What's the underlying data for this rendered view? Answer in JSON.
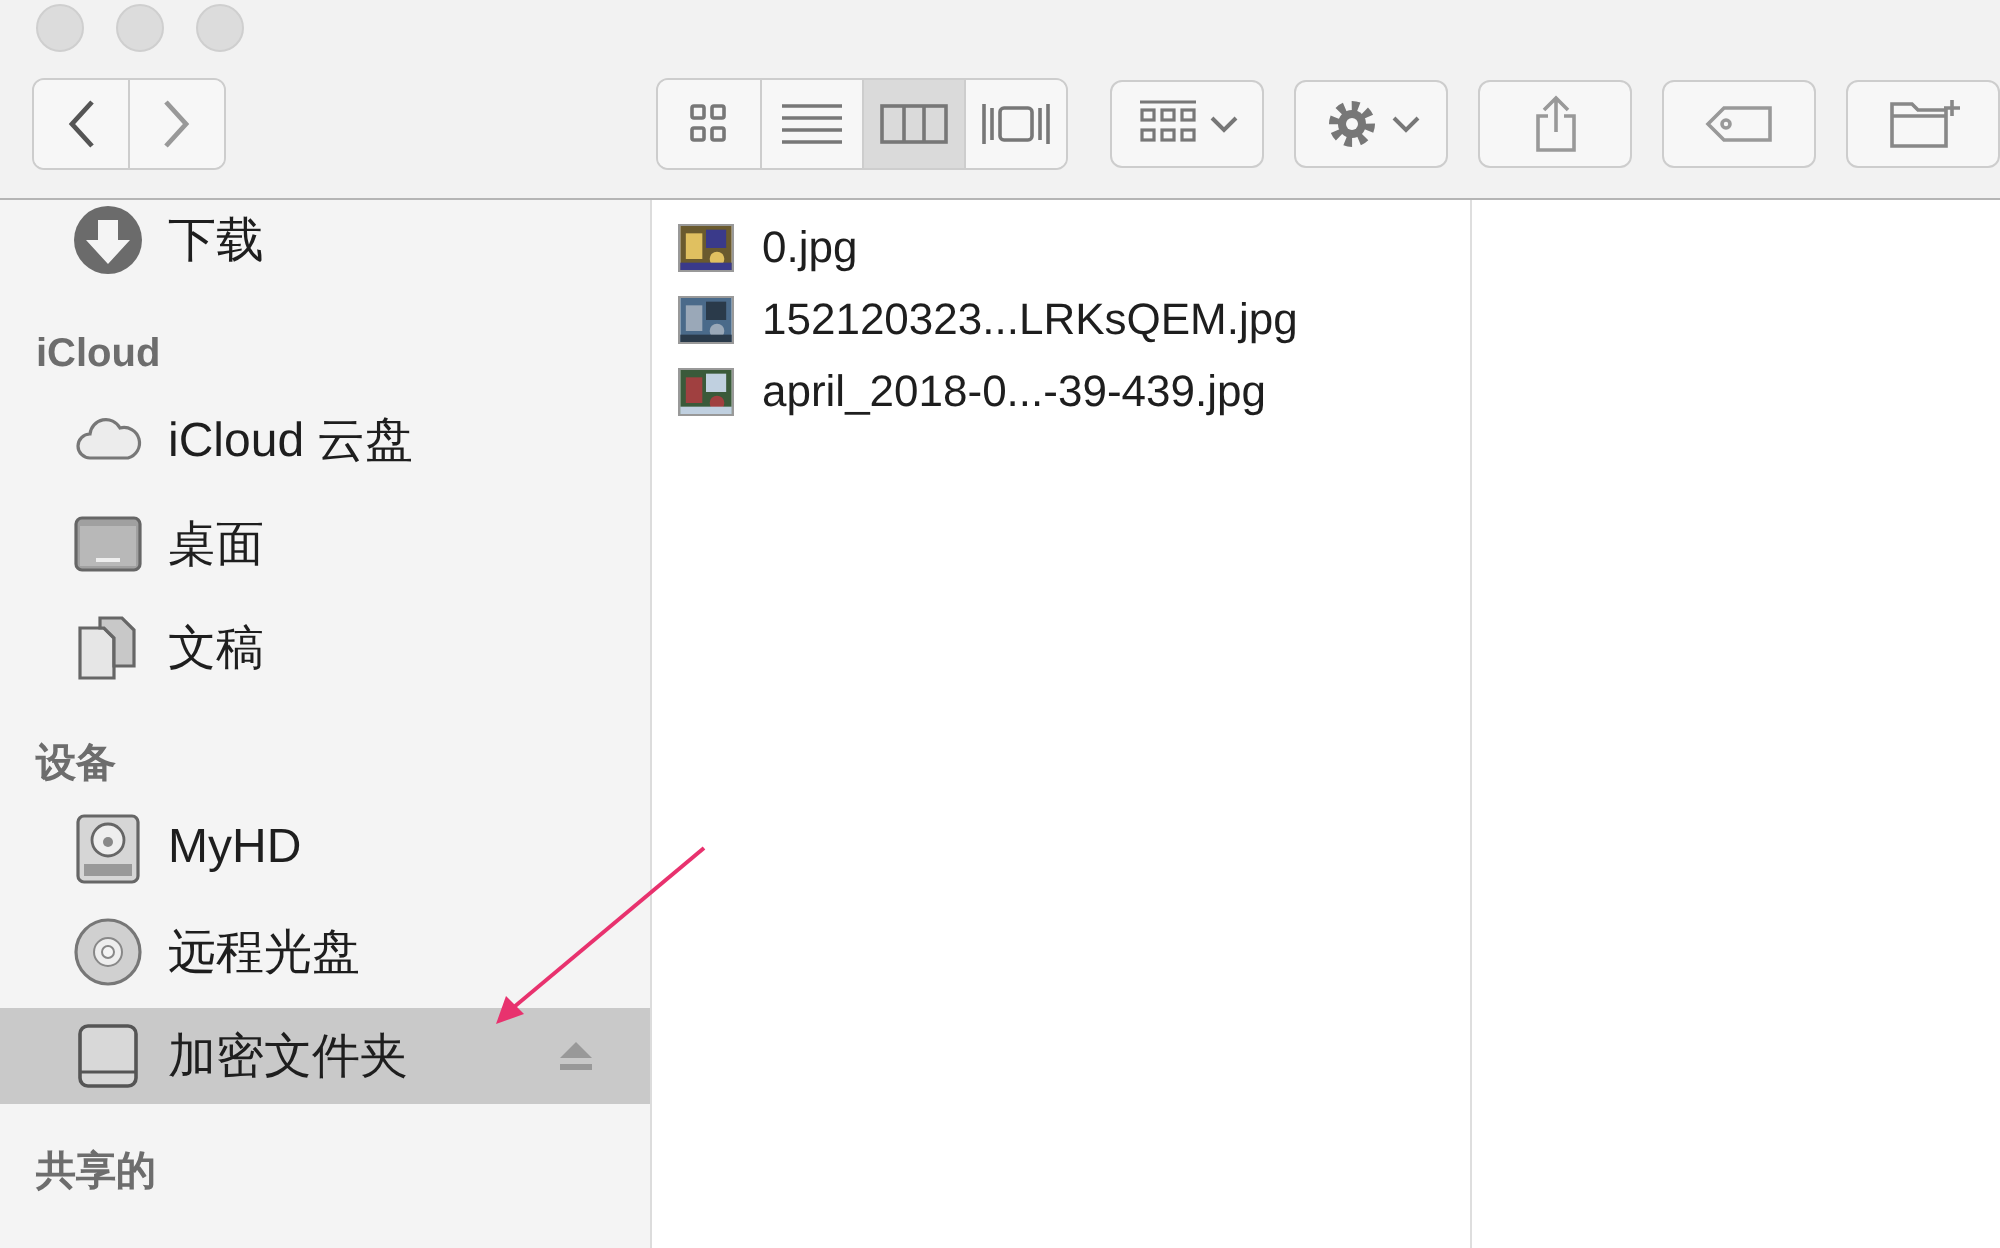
{
  "toolbar": {
    "views": [
      {
        "kind": "icons",
        "selected": false
      },
      {
        "kind": "list",
        "selected": false
      },
      {
        "kind": "columns",
        "selected": true
      },
      {
        "kind": "gallery",
        "selected": false
      }
    ]
  },
  "sidebar": {
    "sections": [
      {
        "items": [
          {
            "label": "下载",
            "kind": "download",
            "selected": false,
            "ejectable": false
          }
        ]
      },
      {
        "title": "iCloud",
        "items": [
          {
            "label": "iCloud 云盘",
            "kind": "cloud",
            "selected": false,
            "ejectable": false
          },
          {
            "label": "桌面",
            "kind": "desktop",
            "selected": false,
            "ejectable": false
          },
          {
            "label": "文稿",
            "kind": "document",
            "selected": false,
            "ejectable": false
          }
        ]
      },
      {
        "title": "设备",
        "items": [
          {
            "label": "MyHD",
            "kind": "disk",
            "selected": false,
            "ejectable": false
          },
          {
            "label": "远程光盘",
            "kind": "optical",
            "selected": false,
            "ejectable": false
          },
          {
            "label": "加密文件夹",
            "kind": "drive",
            "selected": true,
            "ejectable": true
          }
        ]
      },
      {
        "title": "共享的"
      }
    ]
  },
  "files": [
    {
      "name": "0.jpg",
      "selected": false
    },
    {
      "name": "152120323...LRKsQEM.jpg",
      "selected": false
    },
    {
      "name": "april_2018-0...-39-439.jpg",
      "selected": false
    }
  ]
}
